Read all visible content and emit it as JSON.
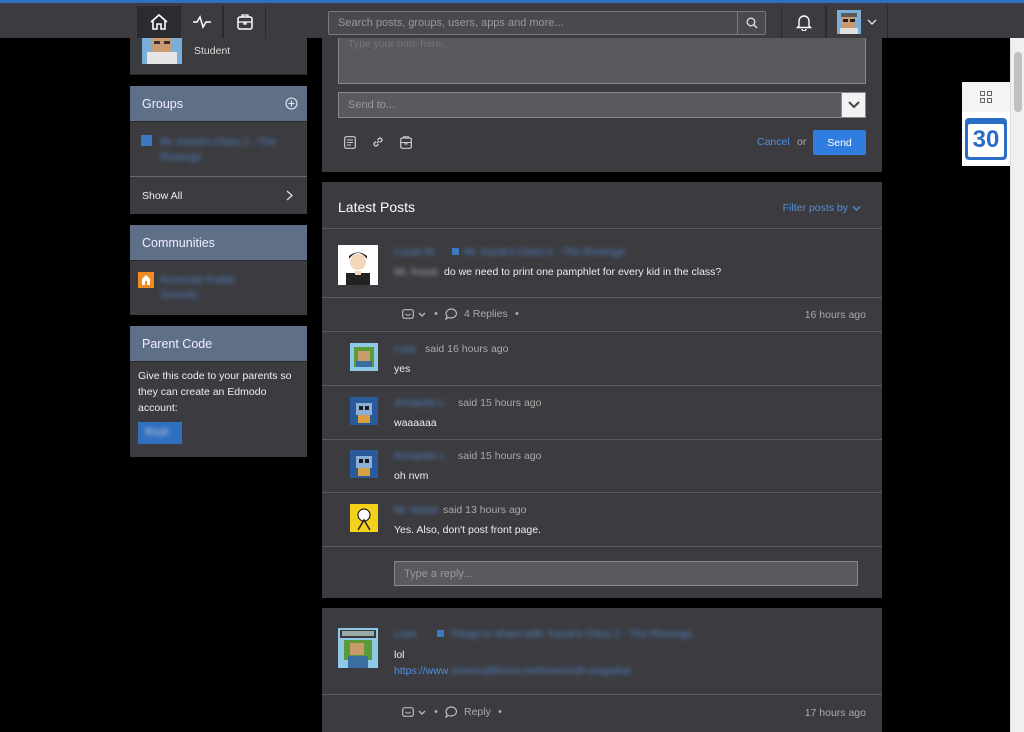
{
  "search": {
    "placeholder": "Search posts, groups, users, apps and more..."
  },
  "profile": {
    "role": "Student"
  },
  "note": {
    "placeholder": "Type your note here...",
    "send_to_placeholder": "Send to...",
    "cancel_label": "Cancel",
    "or_label": "or",
    "send_label": "Send"
  },
  "groups": {
    "title": "Groups",
    "items": [
      {
        "label": "Mr. Kazai's Class 2 - The Revenge"
      }
    ],
    "show_all": "Show All"
  },
  "communities": {
    "title": "Communities",
    "items": [
      {
        "label": "Riverside Public Schools"
      }
    ]
  },
  "parent_code": {
    "title": "Parent Code",
    "text": "Give this code to your parents so they can create an Edmodo account:",
    "code": "f8zpk"
  },
  "feed": {
    "title": "Latest Posts",
    "filter_label": "Filter posts by",
    "posts": [
      {
        "author": "Lucas M.",
        "group": "Mr. Kazai's Class 2 - The Revenge",
        "mention": "Mr. Kazai",
        "text": "do we need to print one pamphlet for every kid in the class?",
        "replies_label": "4 Replies",
        "time": "16 hours ago",
        "replies": [
          {
            "author": "Lucy",
            "meta": "said 16 hours ago",
            "text": "yes"
          },
          {
            "author": "Armando L.",
            "meta": "said 15 hours ago",
            "text": "waaaaaa"
          },
          {
            "author": "Armando L.",
            "meta": "said 15 hours ago",
            "text": "oh nvm"
          },
          {
            "author": "Mr. Kazai",
            "meta": "said 13 hours ago",
            "text": "Yes. Also, don't post front page."
          }
        ],
        "reply_placeholder": "Type a reply..."
      },
      {
        "author": "Liam",
        "group": "Things to share with: Kazai's Class 2 - The Revenge",
        "text": "lol",
        "link_prefix": "https://www",
        "link_rest": ".minecraftforum.net/minecraft-snapshot",
        "reply_label": "Reply",
        "time": "17 hours ago"
      }
    ]
  },
  "calendar_widget": {
    "date": "30"
  },
  "colors": {
    "accent": "#2f6fc0",
    "link": "#4f8ede",
    "panel": "#3c3c40",
    "sidebar_header": "#5f6f87"
  }
}
